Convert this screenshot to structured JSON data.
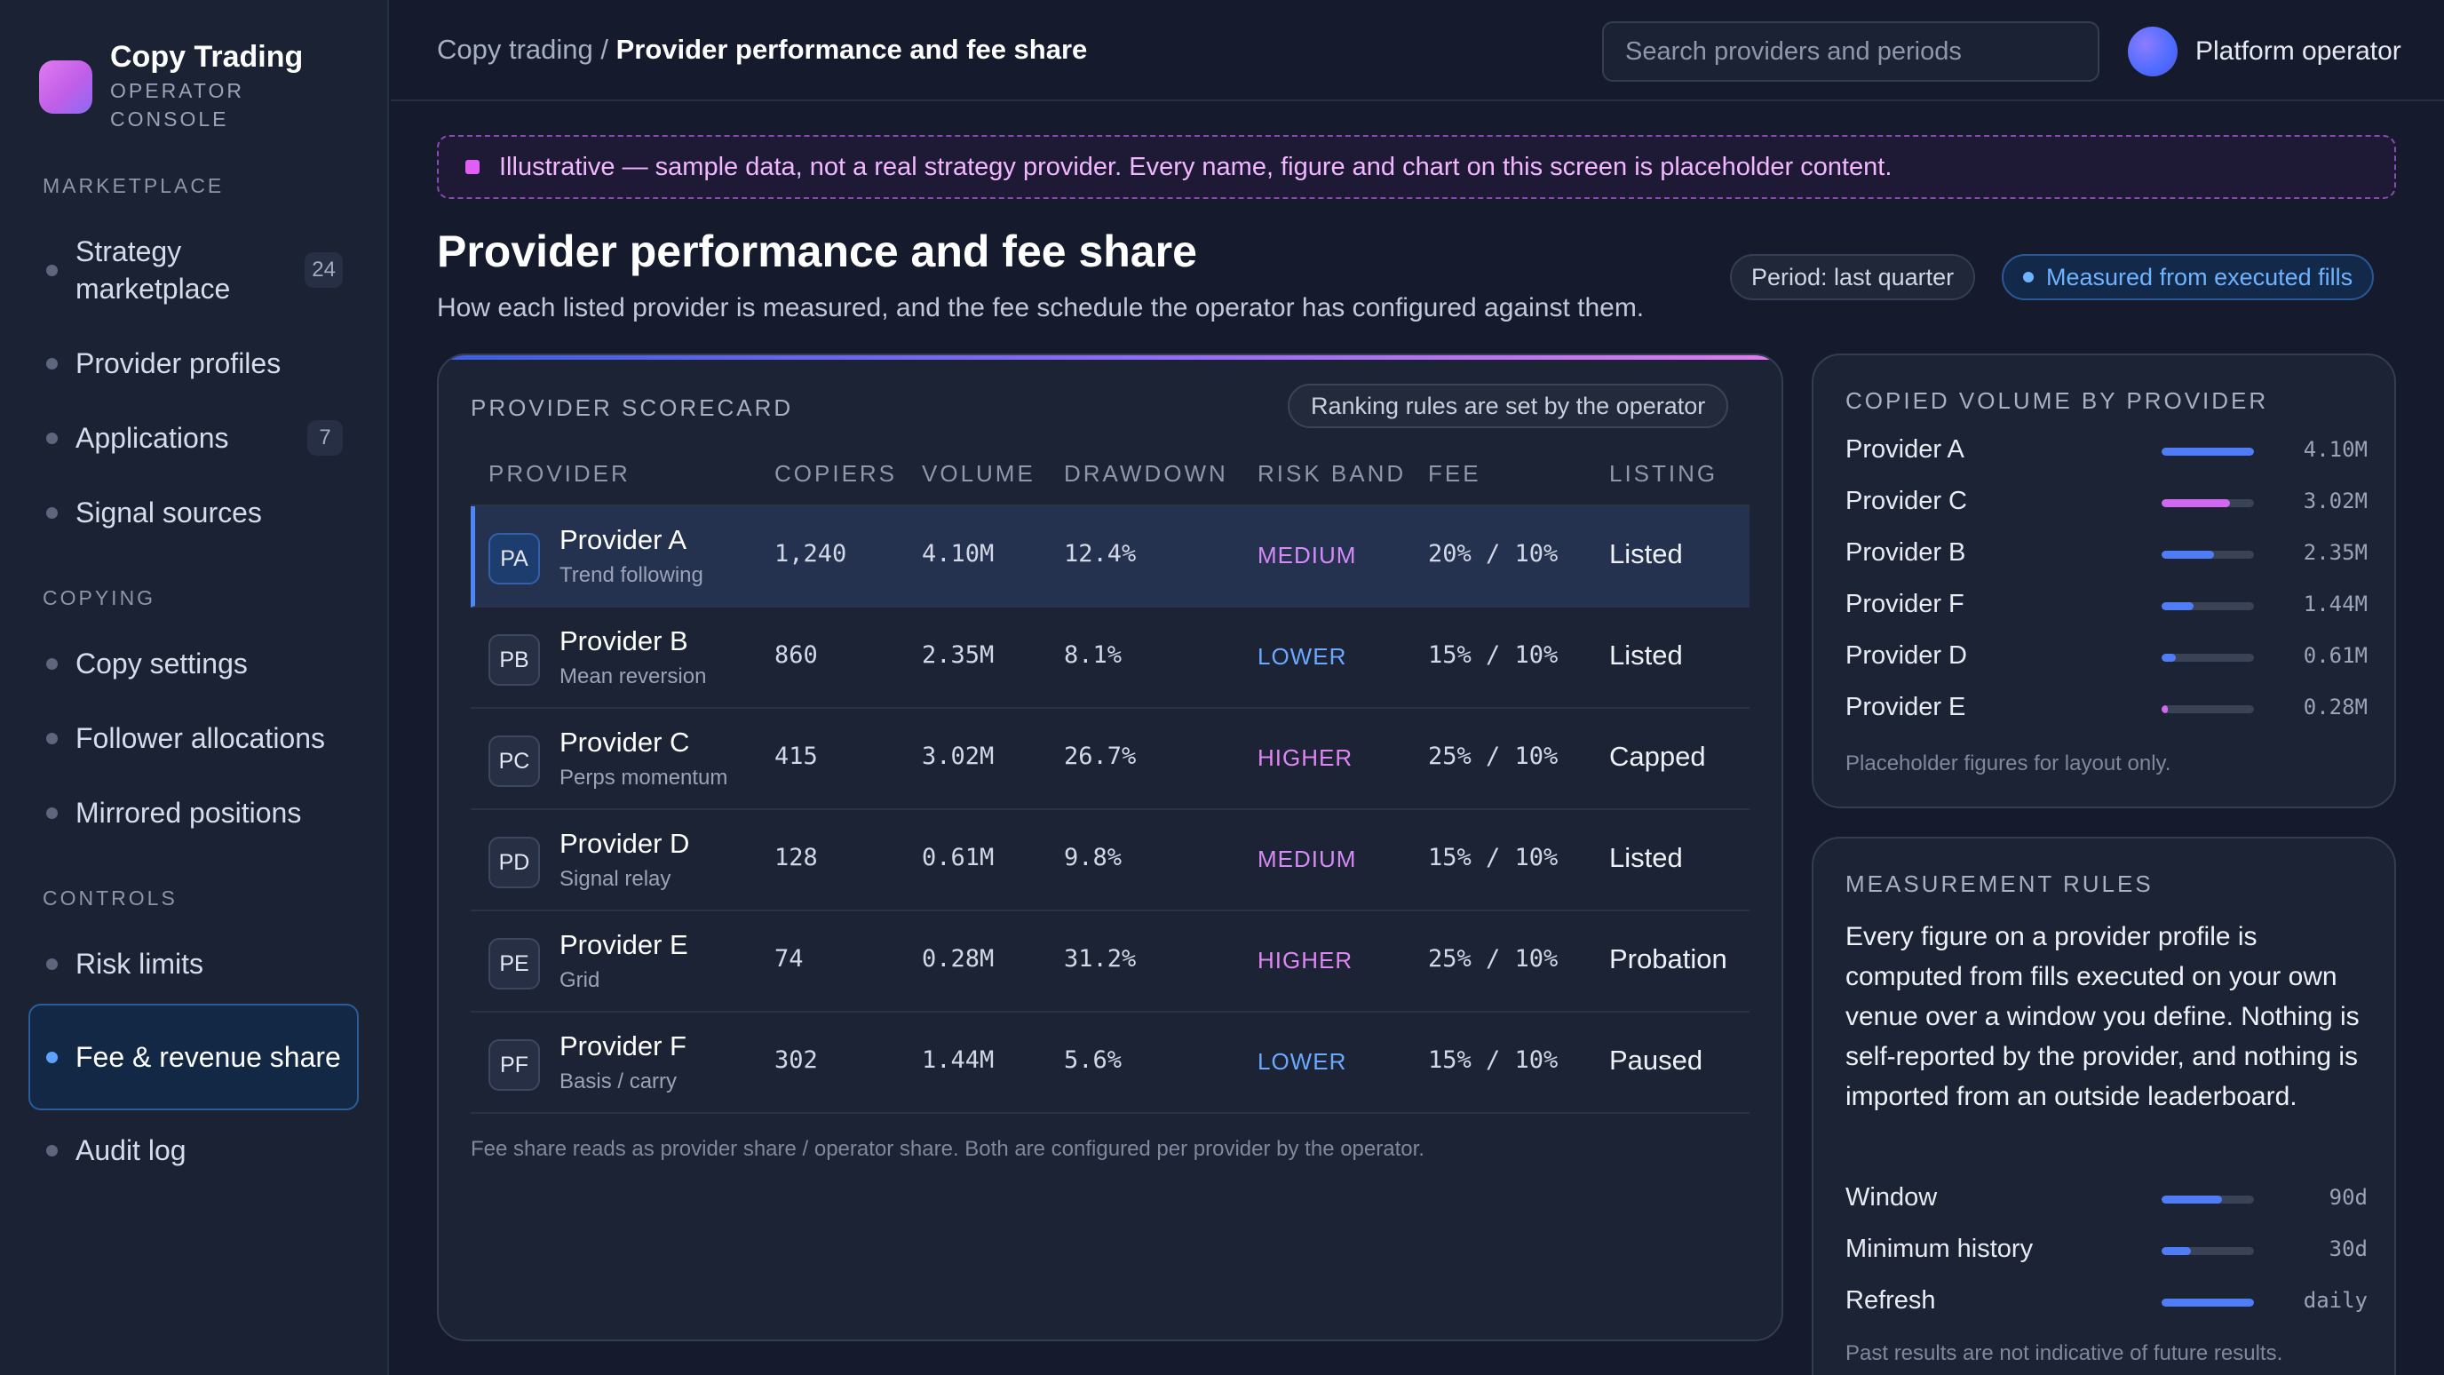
{
  "brand": {
    "title": "Copy Trading",
    "subtitle": "OPERATOR CONSOLE"
  },
  "sidebar": {
    "sections": [
      {
        "label": "MARKETPLACE"
      },
      {
        "label": "COPYING"
      },
      {
        "label": "CONTROLS"
      }
    ],
    "items": [
      {
        "label": "Strategy marketplace",
        "badge": "24"
      },
      {
        "label": "Provider profiles"
      },
      {
        "label": "Applications",
        "badge": "7"
      },
      {
        "label": "Signal sources"
      },
      {
        "label": "Copy settings"
      },
      {
        "label": "Follower allocations"
      },
      {
        "label": "Mirrored positions"
      },
      {
        "label": "Risk limits"
      },
      {
        "label": "Fee & revenue share",
        "active": true
      },
      {
        "label": "Audit log"
      }
    ]
  },
  "header": {
    "breadcrumb_parent": "Copy trading",
    "breadcrumb_sep": " / ",
    "breadcrumb_current": "Provider performance and fee share",
    "search_placeholder": "Search providers and periods",
    "operator_name": "Platform operator"
  },
  "banner": {
    "text": "Illustrative — sample data, not a real strategy provider. Every name, figure and chart on this screen is placeholder content."
  },
  "page": {
    "title": "Provider performance and fee share",
    "subtitle": "How each listed provider is measured, and the fee schedule the operator has configured against them.",
    "chip_period": "Period: last quarter",
    "chip_measured": "Measured from executed fills"
  },
  "scorecard": {
    "heading": "PROVIDER SCORECARD",
    "rank_chip": "Ranking rules are set by the operator",
    "columns": [
      "PROVIDER",
      "COPIERS",
      "VOLUME",
      "DRAWDOWN",
      "RISK BAND",
      "FEE",
      "LISTING"
    ],
    "rows": [
      {
        "initials": "PA",
        "name": "Provider A",
        "strategy": "Trend following",
        "copiers": "1,240",
        "volume": "4.10M",
        "drawdown": "12.4%",
        "risk": "MEDIUM",
        "fee": "20% / 10%",
        "listing": "Listed"
      },
      {
        "initials": "PB",
        "name": "Provider B",
        "strategy": "Mean reversion",
        "copiers": "860",
        "volume": "2.35M",
        "drawdown": "8.1%",
        "risk": "LOWER",
        "fee": "15% / 10%",
        "listing": "Listed"
      },
      {
        "initials": "PC",
        "name": "Provider C",
        "strategy": "Perps momentum",
        "copiers": "415",
        "volume": "3.02M",
        "drawdown": "26.7%",
        "risk": "HIGHER",
        "fee": "25% / 10%",
        "listing": "Capped"
      },
      {
        "initials": "PD",
        "name": "Provider D",
        "strategy": "Signal relay",
        "copiers": "128",
        "volume": "0.61M",
        "drawdown": "9.8%",
        "risk": "MEDIUM",
        "fee": "15% / 10%",
        "listing": "Listed"
      },
      {
        "initials": "PE",
        "name": "Provider E",
        "strategy": "Grid",
        "copiers": "74",
        "volume": "0.28M",
        "drawdown": "31.2%",
        "risk": "HIGHER",
        "fee": "25% / 10%",
        "listing": "Probation"
      },
      {
        "initials": "PF",
        "name": "Provider F",
        "strategy": "Basis / carry",
        "copiers": "302",
        "volume": "1.44M",
        "drawdown": "5.6%",
        "risk": "LOWER",
        "fee": "15% / 10%",
        "listing": "Paused"
      }
    ],
    "footnote": "Fee share reads as provider share / operator share. Both are configured per provider by the operator."
  },
  "copied_volume": {
    "heading": "COPIED VOLUME BY PROVIDER",
    "items": [
      {
        "name": "Provider A",
        "value": "4.10M",
        "fraction": 1.0,
        "color": "#4f7cf7"
      },
      {
        "name": "Provider C",
        "value": "3.02M",
        "fraction": 0.74,
        "color": "#d268f0"
      },
      {
        "name": "Provider B",
        "value": "2.35M",
        "fraction": 0.57,
        "color": "#4f7cf7"
      },
      {
        "name": "Provider F",
        "value": "1.44M",
        "fraction": 0.35,
        "color": "#4f7cf7"
      },
      {
        "name": "Provider D",
        "value": "0.61M",
        "fraction": 0.15,
        "color": "#4f7cf7"
      },
      {
        "name": "Provider E",
        "value": "0.28M",
        "fraction": 0.07,
        "color": "#d268f0"
      }
    ],
    "note": "Placeholder figures for layout only."
  },
  "measurement_rules": {
    "heading": "MEASUREMENT RULES",
    "text": "Every figure on a provider profile is computed from fills executed on your own venue over a window you define. Nothing is self-reported by the provider, and nothing is imported from an outside leaderboard.",
    "items": [
      {
        "name": "Window",
        "value": "90d",
        "fraction": 0.65
      },
      {
        "name": "Minimum history",
        "value": "30d",
        "fraction": 0.32
      },
      {
        "name": "Refresh",
        "value": "daily",
        "fraction": 1.0
      }
    ],
    "note": "Past results are not indicative of future results."
  },
  "colors": {
    "accent": "#4f86f7",
    "magenta": "#d268f0",
    "background": "#151b2c",
    "panel": "#1c2335"
  }
}
